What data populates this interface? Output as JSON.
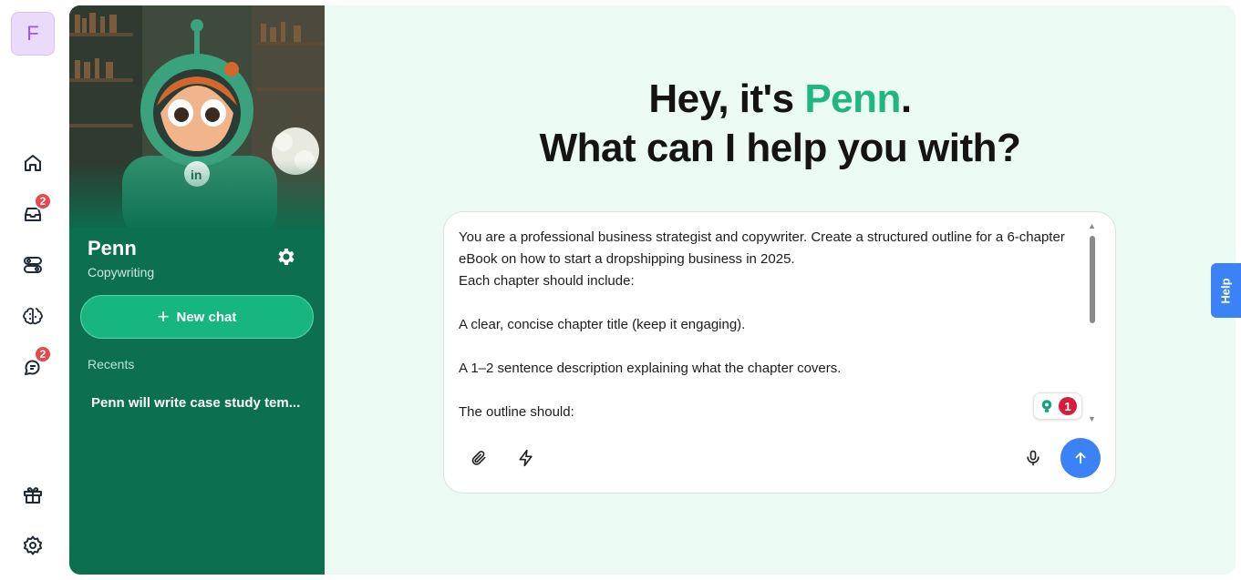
{
  "workspace": {
    "initial": "F"
  },
  "rail": {
    "inbox_badge": "2",
    "chats_badge": "2"
  },
  "agent": {
    "name": "Penn",
    "role": "Copywriting",
    "new_chat_label": "New chat",
    "recents_label": "Recents",
    "recents": [
      "Penn will write case study tem..."
    ]
  },
  "hero": {
    "greeting_prefix": "Hey, it's ",
    "greeting_name": "Penn",
    "greeting_suffix": ".",
    "subtitle": "What can I help you with?"
  },
  "composer": {
    "lines": [
      "You are a professional business strategist and copywriter. Create a structured outline for a 6-chapter eBook on how to start a dropshipping business in 2025.",
      "Each chapter should include:",
      "",
      "A clear, concise chapter title (keep it engaging).",
      "",
      "A 1–2 sentence description explaining what the chapter covers.",
      "",
      "The outline should:"
    ],
    "grammar_count": "1"
  },
  "help_label": "Help",
  "colors": {
    "accent": "#1db77f",
    "panel": "#0b6f50",
    "send": "#3b82f6",
    "badge": "#e5484d"
  }
}
